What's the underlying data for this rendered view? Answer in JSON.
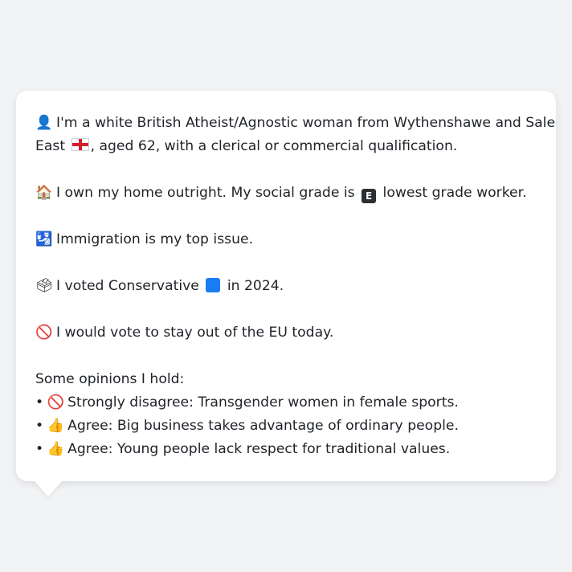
{
  "persona": {
    "identity": {
      "icon": "bust-in-silhouette-icon",
      "icon_glyph": "👤",
      "line1": "I'm a white British Atheist/Agnostic woman from Wythenshawe and Sale",
      "line2_pre": "East",
      "flag_icon": "england-flag-icon",
      "line2_post": ", aged 62, with a clerical or commercial qualification."
    },
    "home": {
      "icon": "house-icon",
      "icon_glyph": "🏠",
      "text_pre": "I own my home outright. My social grade is",
      "grade_badge": "E",
      "text_post": "lowest grade worker."
    },
    "issue": {
      "icon": "passport-control-icon",
      "icon_glyph": "🛂",
      "text": "Immigration is my top issue."
    },
    "vote": {
      "icon": "ballot-box-icon",
      "icon_glyph": "🗳",
      "text_pre": "I voted Conservative",
      "party_color": "#1a7cf2",
      "text_post": "in 2024."
    },
    "eu": {
      "icon": "prohibited-icon",
      "icon_glyph": "🚫",
      "text": "I would vote to stay out of the EU today."
    },
    "opinions": {
      "heading": "Some opinions I hold:",
      "items": [
        {
          "bullet": "•",
          "icon": "prohibited-icon",
          "icon_glyph": "🚫",
          "text": "Strongly disagree: Transgender women in female sports."
        },
        {
          "bullet": "•",
          "icon": "thumbs-up-icon",
          "icon_glyph": "👍",
          "text": "Agree: Big business takes advantage of ordinary people."
        },
        {
          "bullet": "•",
          "icon": "thumbs-up-icon",
          "icon_glyph": "👍",
          "text": "Agree: Young people lack respect for traditional values."
        }
      ]
    }
  }
}
